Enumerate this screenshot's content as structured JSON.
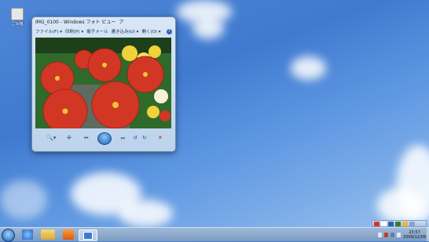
{
  "desktop": {
    "icon_label": "ごみ箱"
  },
  "window": {
    "title": "IMG_0100 - Windows フォト ビュー",
    "title_extra_glyph": "ア",
    "menu": [
      "ファイル(F) ▾",
      "印刷(P) ▾",
      "電子メール",
      "書き込み(U) ▾",
      "開く(O) ▾"
    ],
    "help_glyph": "?"
  },
  "controls": {
    "zoom_glyph": "🔍▾",
    "fit_glyph": "✣",
    "prev_glyph": "⏮",
    "next_glyph": "⏭",
    "rotate_left_glyph": "↺",
    "rotate_right_glyph": "↻",
    "delete_glyph": "✕"
  },
  "taskbar": {
    "clock_time": "23:57",
    "clock_date": "2009/12/09"
  },
  "colors": {
    "flower_red": "#d23624",
    "leaf_green": "#2f6a2a",
    "yellow": "#f1d23a"
  }
}
